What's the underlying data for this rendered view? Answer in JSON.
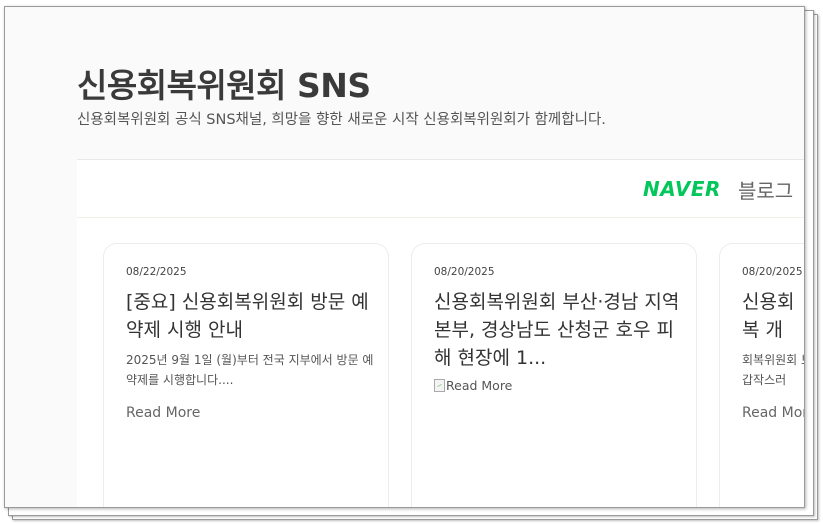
{
  "header": {
    "title": "신용회복위원회 SNS",
    "subtitle": "신용회복위원회 공식 SNS채널, 희망을 향한 새로운 시작 신용회복위원회가 함께합니다."
  },
  "brand": {
    "naver": "NAVER",
    "blog": "블로그",
    "naver_color": "#03c75a"
  },
  "posts": [
    {
      "date": "08/22/2025",
      "title": "[중요] 신용회복위원회 방문 예약제 시행 안내",
      "excerpt": "2025년 9월 1일 (월)부터 전국 지부에서 방문 예약제를 시행합니다....",
      "more": "Read More"
    },
    {
      "date": "08/20/2025",
      "title": "신용회복위원회 부산·경남 지역본부, 경상남도 산청군 호우 피해 현장에 1...",
      "image_alt": "Read More"
    },
    {
      "date": "08/20/2025",
      "title": "신용회복 개",
      "excerpt": "회복위원회 보 갑작스러",
      "more": "Read More"
    }
  ]
}
